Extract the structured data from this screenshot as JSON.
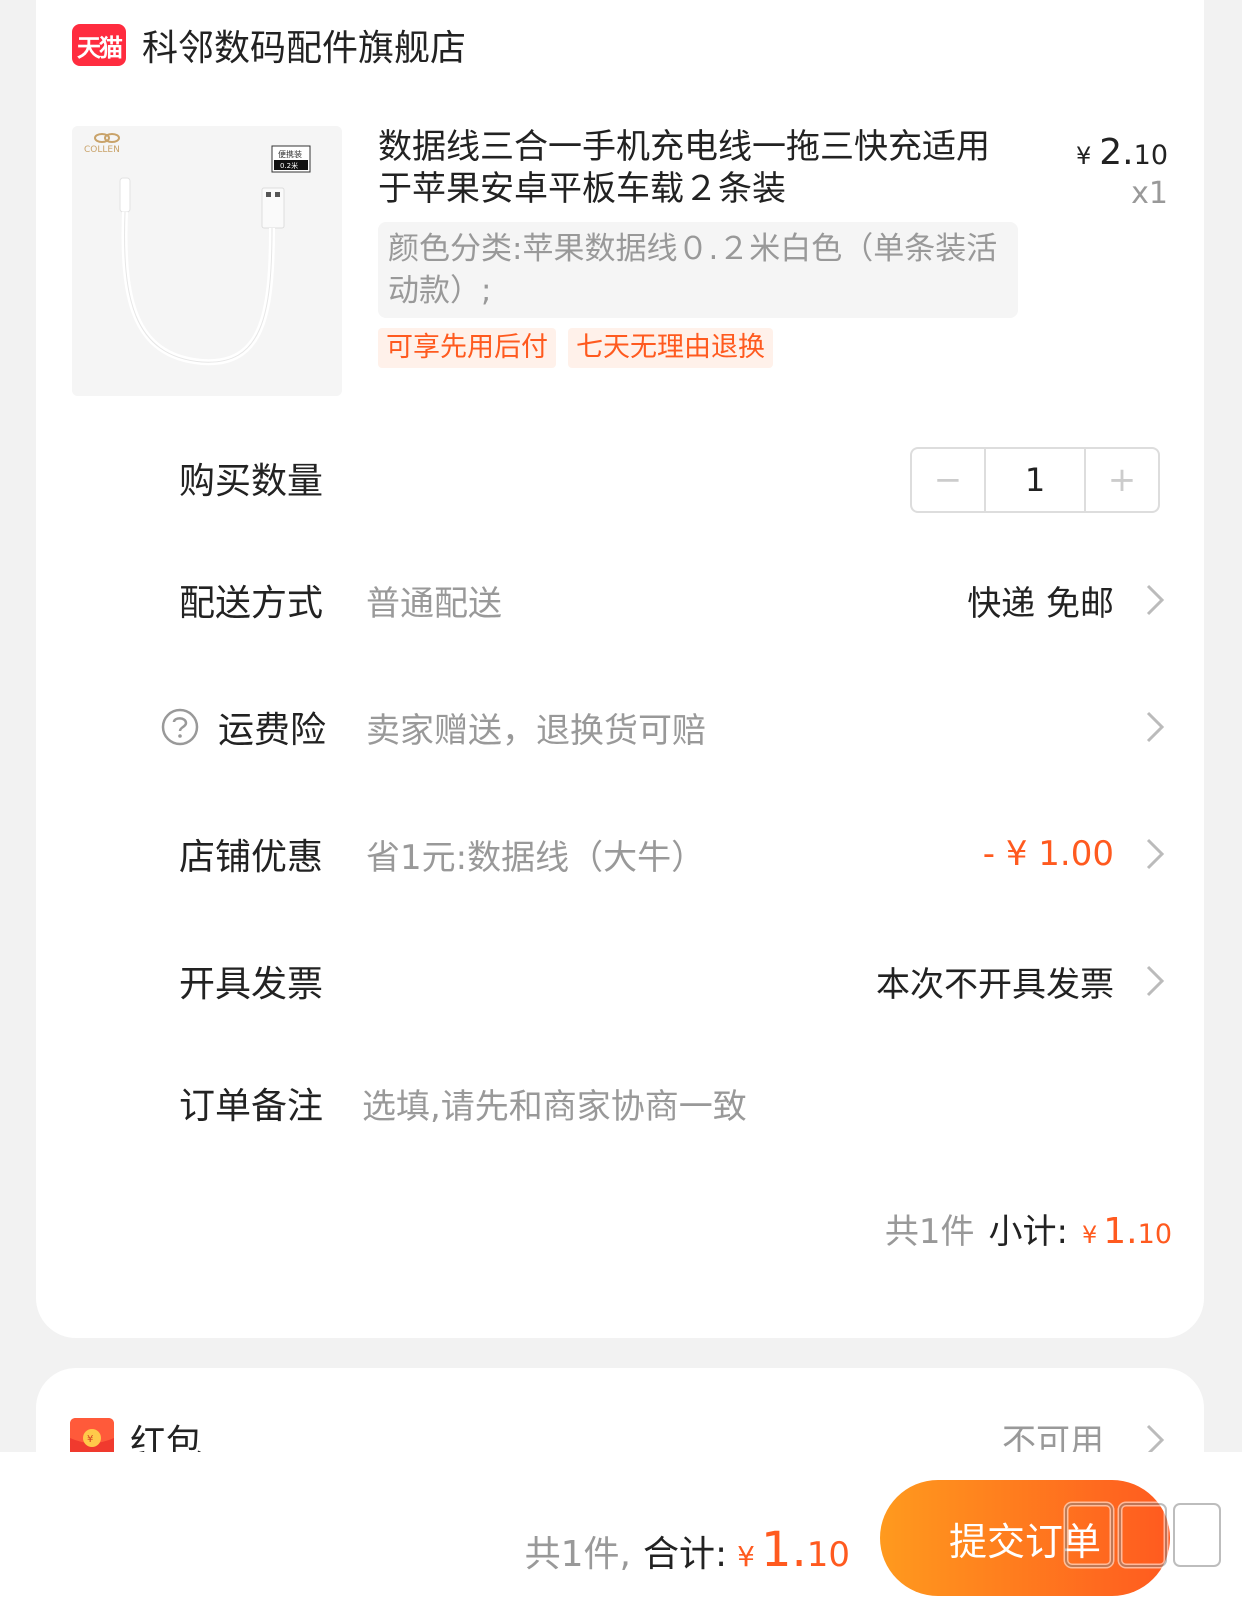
{
  "store": {
    "badge": "天猫",
    "name": "科邻数码配件旗舰店"
  },
  "product": {
    "image_brand": "COLLEN",
    "image_tag_line1": "便携装",
    "image_tag_line2": "0.2米",
    "title": "数据线三合一手机充电线一拖三快充适用于苹果安卓平板车载２条装",
    "price_yen": "¥",
    "price_int": "2.",
    "price_dec": "10",
    "quantity_tag": "x1",
    "spec": "颜色分类:苹果数据线０.２米白色（单条装活动款）;",
    "tags": [
      "可享先用后付",
      "七天无理由退换"
    ]
  },
  "quantity": {
    "label": "购买数量",
    "minus": "−",
    "value": "1",
    "plus": "+"
  },
  "delivery": {
    "label": "配送方式",
    "sub": "普通配送",
    "value": "快递 免邮"
  },
  "insurance": {
    "label": "运费险",
    "sub": "卖家赠送，退换货可赔"
  },
  "discount": {
    "label": "店铺优惠",
    "sub": "省1元:数据线（大牛）",
    "value": "- ¥ 1.00"
  },
  "invoice": {
    "label": "开具发票",
    "value": "本次不开具发票"
  },
  "note": {
    "label": "订单备注",
    "placeholder": "选填,请先和商家协商一致"
  },
  "subtotal": {
    "count": "共1件",
    "label": "小计:",
    "yen": "¥",
    "int": "1.",
    "dec": "10"
  },
  "redpacket": {
    "label": "红包",
    "status": "不可用"
  },
  "footer": {
    "count": "共1件,",
    "label": "合计:",
    "yen": "¥",
    "int": "1.",
    "dec": "10",
    "submit": "提交订单"
  },
  "colors": {
    "accent": "#ff5a1f",
    "tmall_red": "#ff2c3f",
    "muted": "#999999"
  }
}
